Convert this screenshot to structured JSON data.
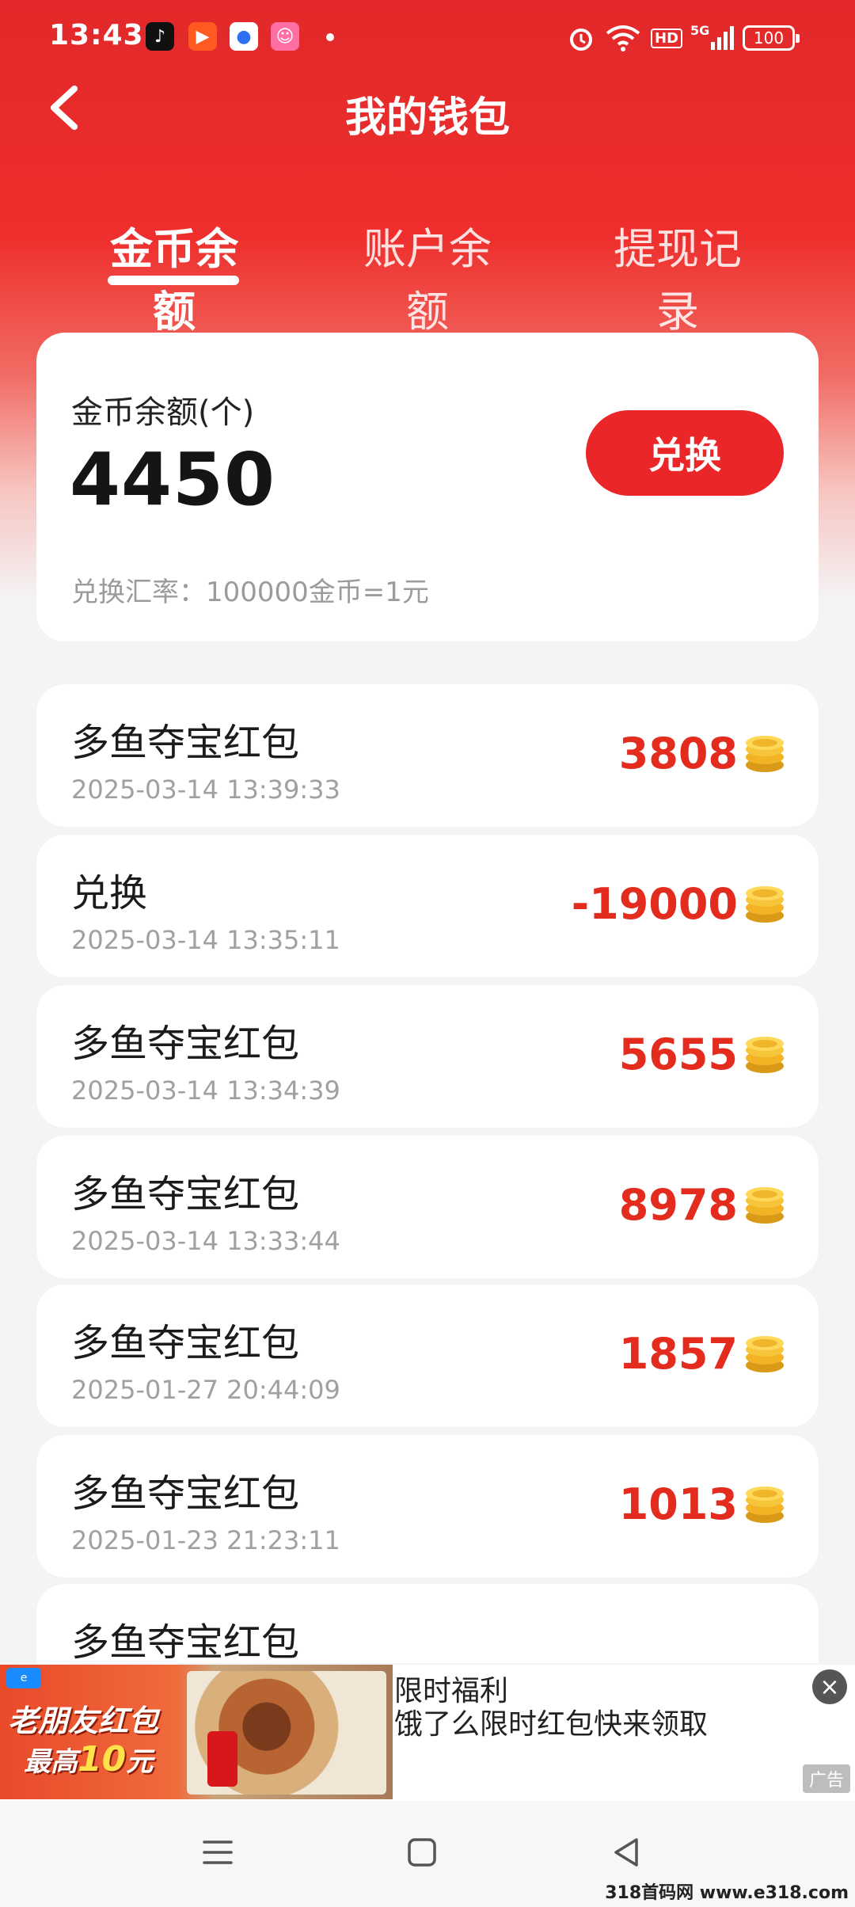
{
  "status_bar": {
    "time": "13:43",
    "hd": "HD",
    "network": "5G",
    "battery": "100"
  },
  "header": {
    "title": "我的钱包"
  },
  "tabs": [
    {
      "label": "金币余额",
      "active": true
    },
    {
      "label": "账户余额",
      "active": false
    },
    {
      "label": "提现记录",
      "active": false
    }
  ],
  "balance": {
    "label": "金币余额(个)",
    "value": "4450",
    "exchange_label": "兑换",
    "rate_text": "兑换汇率：100000金币=1元"
  },
  "records": [
    {
      "title": "多鱼夺宝红包",
      "time": "2025-03-14 13:39:33",
      "amount": "3808"
    },
    {
      "title": "兑换",
      "time": "2025-03-14 13:35:11",
      "amount": "-19000"
    },
    {
      "title": "多鱼夺宝红包",
      "time": "2025-03-14 13:34:39",
      "amount": "5655"
    },
    {
      "title": "多鱼夺宝红包",
      "time": "2025-03-14 13:33:44",
      "amount": "8978"
    },
    {
      "title": "多鱼夺宝红包",
      "time": "2025-01-27 20:44:09",
      "amount": "1857"
    },
    {
      "title": "多鱼夺宝红包",
      "time": "2025-01-23 21:23:11",
      "amount": "1013"
    },
    {
      "title": "多鱼夺宝红包",
      "time": "",
      "amount": ""
    }
  ],
  "ad": {
    "image_line1": "老朋友红包",
    "image_line2_prefix": "最高",
    "image_line2_num": "10",
    "image_line2_suffix": "元",
    "title": "限时福利",
    "description": "饿了么限时红包快来领取",
    "tag": "广告"
  },
  "watermark": "318首码网 www.e318.com",
  "colors": {
    "brand_red": "#ea2628",
    "amount_red": "#e32c1e",
    "page_bg": "#f4f4f6"
  }
}
